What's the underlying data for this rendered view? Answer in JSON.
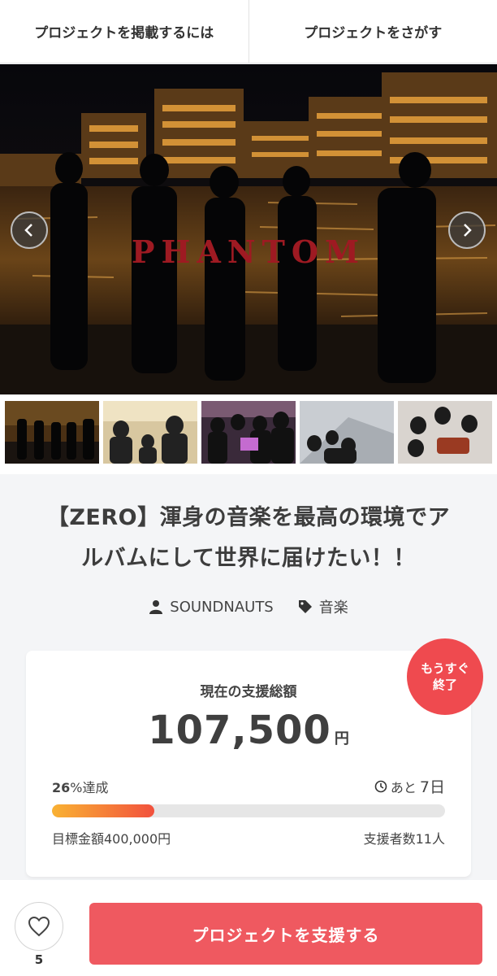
{
  "nav": {
    "post_project": "プロジェクトを掲載するには",
    "find_project": "プロジェクトをさがす"
  },
  "hero": {
    "logo_text": "PHANTOM"
  },
  "project": {
    "title_line1": "【ZERO】渾身の音楽を最高の環境でア",
    "title_line2": "ルバムにして世界に届けたい！！",
    "owner": "SOUNDNAUTS",
    "category": "音楽"
  },
  "funding": {
    "label": "現在の支援総額",
    "amount": "107,500",
    "unit": "円",
    "percent": "26",
    "percent_suffix": "%達成",
    "remain_prefix": "あと",
    "remain_days": "7日",
    "progress": 0.26,
    "goal": "目標金額400,000円",
    "backers": "支援者数11人",
    "badge_line1": "もうすぐ",
    "badge_line2": "終了"
  },
  "footer": {
    "fav_count": "5",
    "support_label": "プロジェクトを支援する"
  },
  "colors": {
    "accent": "#ef5960",
    "badge": "#ef4a4f",
    "progress_start": "#f9b233",
    "progress_end": "#f2513d",
    "logo": "#9e1a22"
  }
}
